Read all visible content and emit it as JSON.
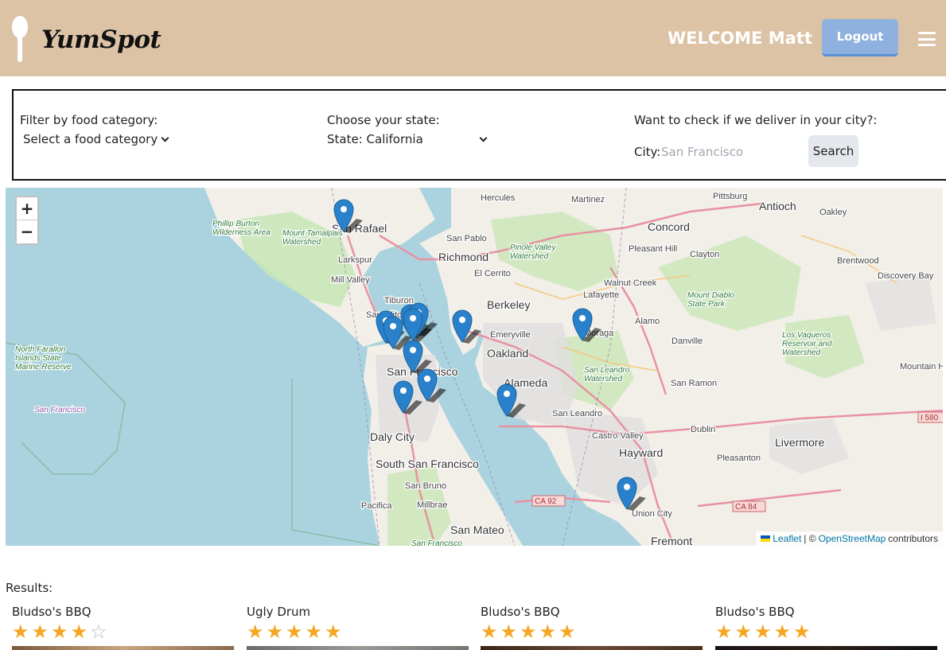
{
  "header": {
    "brand": "YumSpot",
    "welcome": "WELCOME Matt",
    "logout_label": "Logout",
    "bg_color": "#dcc3a6"
  },
  "filters": {
    "category_label": "Filter by food category:",
    "category_selected": "Select a food category",
    "state_label": "Choose your state:",
    "state_selected": "State: California",
    "city_check_label": "Want to check if we deliver in your city?:",
    "city_field_label": "City:",
    "city_placeholder": "San Francisco",
    "search_label": "Search"
  },
  "map": {
    "zoom_in": "+",
    "zoom_out": "−",
    "attribution": {
      "leaflet": "Leaflet",
      "separator": "| ©",
      "osm": "OpenStreetMap",
      "contributors": "contributors"
    },
    "place_labels": [
      {
        "text": "San Rafael",
        "kind": "city"
      },
      {
        "text": "Hercules",
        "kind": "town"
      },
      {
        "text": "Martinez",
        "kind": "town"
      },
      {
        "text": "Pittsburg",
        "kind": "town"
      },
      {
        "text": "Antioch",
        "kind": "city"
      },
      {
        "text": "Oakley",
        "kind": "town"
      },
      {
        "text": "Concord",
        "kind": "city"
      },
      {
        "text": "San Pablo",
        "kind": "town"
      },
      {
        "text": "Richmond",
        "kind": "city"
      },
      {
        "text": "Pinole Valley Watershed",
        "kind": "park"
      },
      {
        "text": "Pleasant Hill",
        "kind": "town"
      },
      {
        "text": "Clayton",
        "kind": "town"
      },
      {
        "text": "Brentwood",
        "kind": "town"
      },
      {
        "text": "Phillip Burton Wilderness Area",
        "kind": "park"
      },
      {
        "text": "Mount Tamalpais Watershed",
        "kind": "park"
      },
      {
        "text": "Larkspur",
        "kind": "town"
      },
      {
        "text": "El Cerrito",
        "kind": "town"
      },
      {
        "text": "Walnut Creek",
        "kind": "town"
      },
      {
        "text": "Discovery Bay",
        "kind": "town"
      },
      {
        "text": "Mill Valley",
        "kind": "town"
      },
      {
        "text": "Lafayette",
        "kind": "town"
      },
      {
        "text": "Mount Diablo State Park",
        "kind": "park"
      },
      {
        "text": "Tiburon",
        "kind": "town"
      },
      {
        "text": "Berkeley",
        "kind": "city"
      },
      {
        "text": "Sausalito",
        "kind": "town"
      },
      {
        "text": "Alamo",
        "kind": "town"
      },
      {
        "text": "Emeryville",
        "kind": "town"
      },
      {
        "text": "Moraga",
        "kind": "town"
      },
      {
        "text": "Los Vaqueros Reservoir and Watershed",
        "kind": "park"
      },
      {
        "text": "North Farallon Islands State Marine Reserve",
        "kind": "park"
      },
      {
        "text": "Danville",
        "kind": "town"
      },
      {
        "text": "Oakland",
        "kind": "city"
      },
      {
        "text": "Mountain House",
        "kind": "town"
      },
      {
        "text": "San Francisco",
        "kind": "city"
      },
      {
        "text": "San Leandro Watershed",
        "kind": "park"
      },
      {
        "text": "Alameda",
        "kind": "city"
      },
      {
        "text": "San Ramon",
        "kind": "town"
      },
      {
        "text": "San Francisco",
        "kind": "county"
      },
      {
        "text": "San Leandro",
        "kind": "town"
      },
      {
        "text": "I 580",
        "kind": "shield"
      },
      {
        "text": "Dublin",
        "kind": "town"
      },
      {
        "text": "Castro Valley",
        "kind": "town"
      },
      {
        "text": "Daly City",
        "kind": "city"
      },
      {
        "text": "Hayward",
        "kind": "city"
      },
      {
        "text": "Livermore",
        "kind": "city"
      },
      {
        "text": "Pleasanton",
        "kind": "town"
      },
      {
        "text": "South San Francisco",
        "kind": "city"
      },
      {
        "text": "San Bruno",
        "kind": "town"
      },
      {
        "text": "CA 92",
        "kind": "shield"
      },
      {
        "text": "Pacifica",
        "kind": "town"
      },
      {
        "text": "Millbrae",
        "kind": "town"
      },
      {
        "text": "CA 84",
        "kind": "shield"
      },
      {
        "text": "Union City",
        "kind": "town"
      },
      {
        "text": "San Mateo",
        "kind": "city"
      },
      {
        "text": "Fremont",
        "kind": "city"
      },
      {
        "text": "San Francisco",
        "kind": "park"
      }
    ],
    "marker_count": 13
  },
  "results": {
    "label": "Results:",
    "cards": [
      {
        "name": "Bludso's BBQ",
        "rating": 4
      },
      {
        "name": "Ugly Drum",
        "rating": 5
      },
      {
        "name": "Bludso's BBQ",
        "rating": 5
      },
      {
        "name": "Bludso's BBQ",
        "rating": 5
      }
    ],
    "star_color": "#f5a623"
  }
}
